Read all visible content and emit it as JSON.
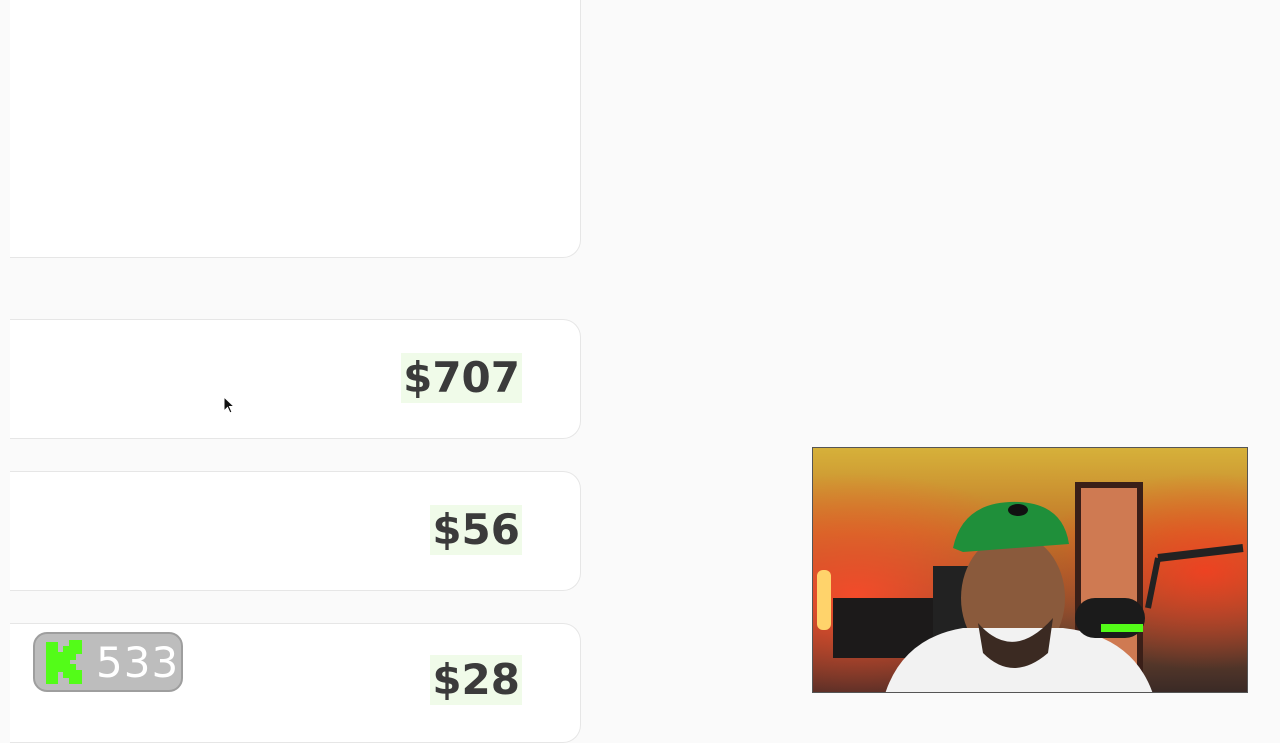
{
  "rows": [
    {
      "amount": "$707"
    },
    {
      "amount": "$56"
    },
    {
      "amount": "$28"
    }
  ],
  "badge": {
    "count": "533",
    "icon": "kick-logo-icon",
    "color": "#53fc18"
  },
  "colors": {
    "amount_bg": "#f0fbe9",
    "card_bg": "#ffffff",
    "page_bg": "#fafafa"
  }
}
